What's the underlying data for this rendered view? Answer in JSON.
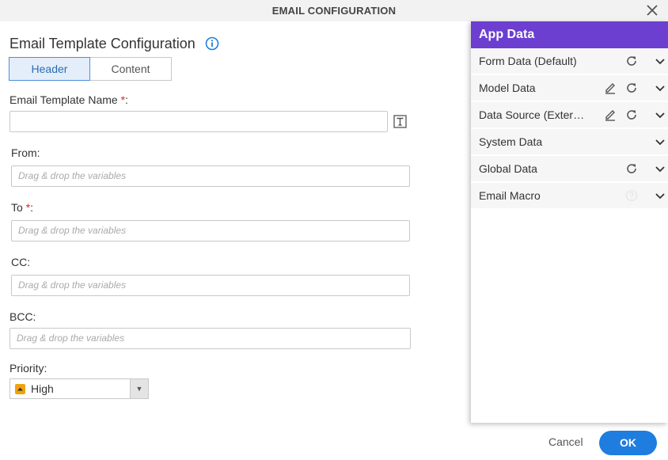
{
  "window": {
    "title": "EMAIL CONFIGURATION"
  },
  "section": {
    "title": "Email Template Configuration"
  },
  "tabs": [
    {
      "label": "Header",
      "active": true
    },
    {
      "label": "Content",
      "active": false
    }
  ],
  "form": {
    "template_name": {
      "label": "Email Template Name",
      "required_mark": "*",
      "suffix": ":",
      "value": ""
    },
    "from": {
      "label": "From:",
      "placeholder": "Drag & drop the variables"
    },
    "to": {
      "label": "To ",
      "required_mark": "*",
      "suffix": ":",
      "placeholder": "Drag & drop the variables"
    },
    "cc": {
      "label": "CC:",
      "placeholder": "Drag & drop the variables"
    },
    "bcc": {
      "label": "BCC:",
      "placeholder": "Drag & drop the variables"
    },
    "priority": {
      "label": "Priority:",
      "value": "High"
    }
  },
  "app_data": {
    "title": "App Data",
    "items": [
      {
        "label": "Form Data (Default)",
        "edit": false,
        "refresh": true
      },
      {
        "label": "Model Data",
        "edit": true,
        "refresh": true
      },
      {
        "label": "Data Source (External)",
        "edit": true,
        "refresh": true
      },
      {
        "label": "System Data",
        "edit": false,
        "refresh": false
      },
      {
        "label": "Global Data",
        "edit": false,
        "refresh": true
      },
      {
        "label": "Email Macro",
        "edit": false,
        "refresh": false,
        "help": true
      }
    ]
  },
  "footer": {
    "cancel_label": "Cancel",
    "ok_label": "OK"
  },
  "colors": {
    "accent": "#1f7de0",
    "panel_header": "#6c3fd1",
    "required": "#d9232e",
    "priority_high": "#f0a30a"
  }
}
